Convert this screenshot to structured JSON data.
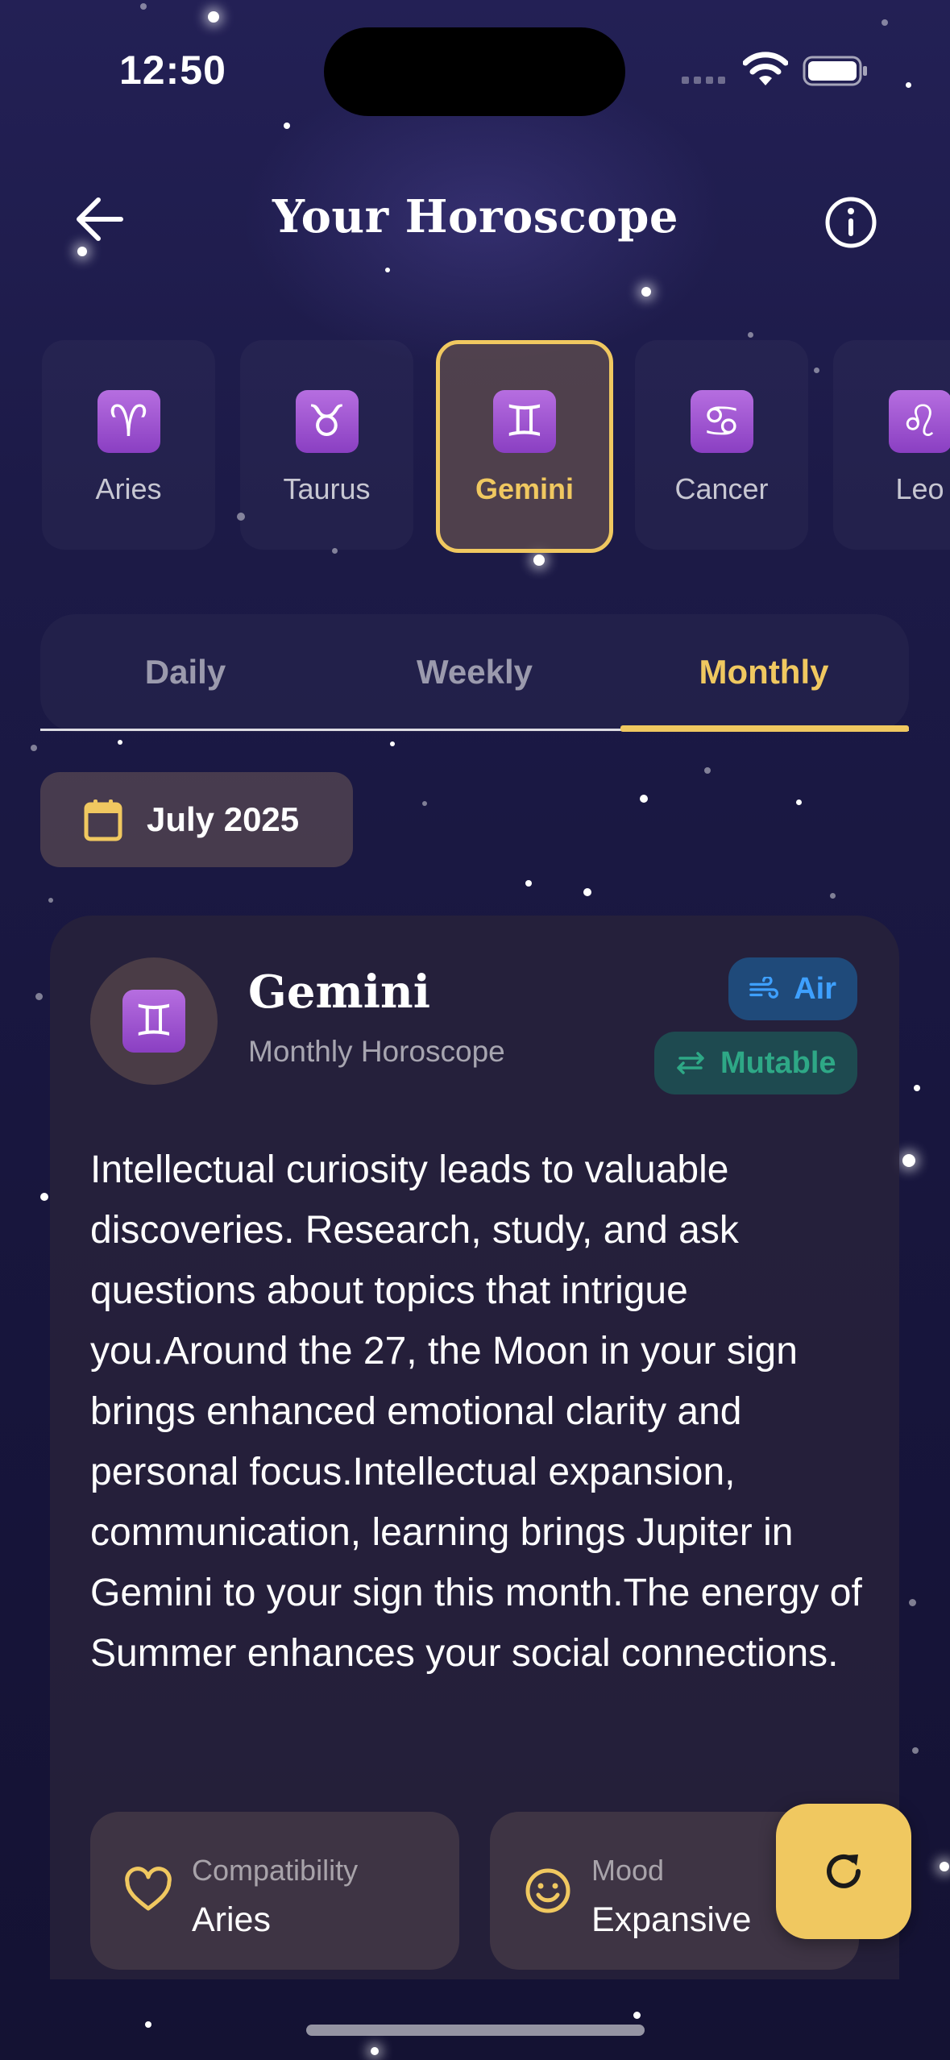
{
  "status_bar": {
    "time": "12:50"
  },
  "header": {
    "title": "Your Horoscope"
  },
  "signs": [
    {
      "glyph": "♈",
      "label": "Aries"
    },
    {
      "glyph": "♉",
      "label": "Taurus"
    },
    {
      "glyph": "♊",
      "label": "Gemini",
      "selected": true
    },
    {
      "glyph": "♋",
      "label": "Cancer"
    },
    {
      "glyph": "♌",
      "label": "Leo"
    }
  ],
  "tabs": [
    {
      "label": "Daily"
    },
    {
      "label": "Weekly"
    },
    {
      "label": "Monthly",
      "selected": true
    }
  ],
  "date_chip": {
    "label": "July 2025"
  },
  "card": {
    "glyph": "♊",
    "title": "Gemini",
    "subtitle": "Monthly Horoscope",
    "element_badge": "Air",
    "modality_badge": "Mutable",
    "body": "Intellectual curiosity leads to valuable discoveries. Research, study, and ask questions about topics that intrigue you.Around the 27, the Moon in your sign brings enhanced emotional clarity and personal focus.Intellectual expansion, communication, learning brings Jupiter in Gemini to your sign this month.The energy of Summer enhances your social connections.",
    "stats": [
      {
        "label": "Compatibility",
        "value": "Aries",
        "icon": "heart-icon"
      },
      {
        "label": "Mood",
        "value": "Expansive",
        "icon": "smile-icon"
      }
    ]
  },
  "colors": {
    "accent": "#f0c860",
    "air_badge_text": "#3ea0ff",
    "mutable_badge_text": "#2ea886",
    "sign_glyph_bg": "#9a52d0"
  },
  "icons": {
    "back": "arrow-left-icon",
    "info": "info-icon",
    "calendar": "calendar-icon",
    "air": "wind-icon",
    "mutable": "swap-arrows-icon",
    "refresh": "refresh-icon"
  }
}
